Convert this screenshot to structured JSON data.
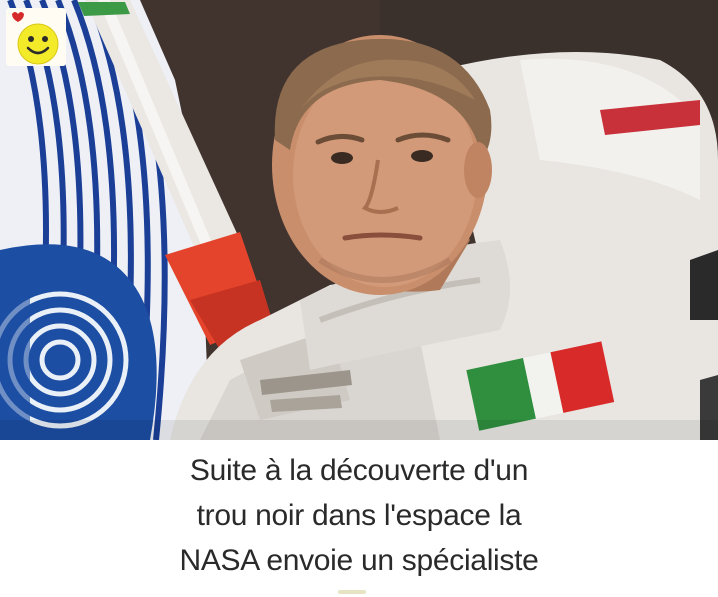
{
  "caption": {
    "lines": [
      "Suite à la découverte d'un",
      "trou noir dans l'espace la",
      "NASA envoie un spécialiste"
    ]
  },
  "photo": {
    "subject": "man in white spacesuit with Italian flag patch",
    "flag_colors": [
      "#2f8f3e",
      "#f2f2ee",
      "#d92a2a"
    ],
    "background_color": "#3f3431"
  },
  "badge": {
    "icon": "smiley-face-icon",
    "face_color": "#f3ea2a"
  }
}
